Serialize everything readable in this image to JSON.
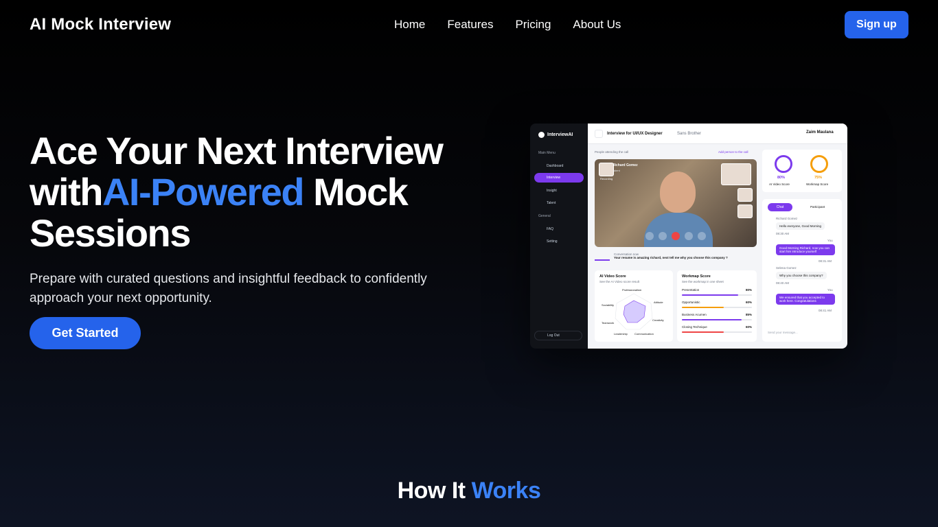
{
  "nav": {
    "logo": "AI Mock Interview",
    "links": [
      "Home",
      "Features",
      "Pricing",
      "About Us"
    ],
    "signup": "Sign up"
  },
  "hero": {
    "title_line1": "Ace Your Next Interview",
    "title_with": "with",
    "title_highlight": "AI-Powered",
    "title_rest": " Mock Sessions",
    "subtitle": "Prepare with curated questions and insightful feedback to confidently approach your next opportunity.",
    "cta": "Get Started"
  },
  "how": {
    "part1": "How It ",
    "part2": "Works"
  },
  "colors": {
    "accent": "#2563eb",
    "highlight": "#3b82f6",
    "mock_purple": "#7c3aed"
  },
  "mock": {
    "brand": "InterviewAI",
    "sections": {
      "main": "Main Menu",
      "general": "General"
    },
    "menu": [
      "Dashboard",
      "Interview",
      "Insight",
      "Talent"
    ],
    "general_items": [
      "FAQ",
      "Setting"
    ],
    "logout": "Log Out",
    "header_title": "Interview for UI/UX Designer",
    "header_sub": "Sans Brother",
    "user": "Zaim Maulana",
    "attending": "People attending the call",
    "add_person": "Add person to the call",
    "caller_name": "Richard Gomez",
    "caller_role": "Talent",
    "recording": "Recording",
    "conversation_label": "Conversation now",
    "conversation_text": "Your resume is amazing richard, next tell me why you choose this company ?",
    "ai_score_title": "AI Video Score",
    "ai_score_sub": "See the AI Video score result",
    "radar_labels": [
      "Professionalism",
      "Attitude",
      "Creativity",
      "Communication",
      "Leadership",
      "Teamwork",
      "Sociability"
    ],
    "work_title": "Workmap Score",
    "work_sub": "See the workmap in one sheet",
    "work_items": [
      {
        "label": "Presentation",
        "value": "80%",
        "pct": 0.8,
        "color": "#7c3aed"
      },
      {
        "label": "Opportunistic",
        "value": "60%",
        "pct": 0.6,
        "color": "#f59e0b"
      },
      {
        "label": "Business Acumen",
        "value": "85%",
        "pct": 0.85,
        "color": "#7c3aed"
      },
      {
        "label": "Closing Technique",
        "value": "60%",
        "pct": 0.6,
        "color": "#ef4444"
      }
    ],
    "scores": [
      {
        "value": "80%",
        "label": "AI Video Score",
        "color": "#7c3aed"
      },
      {
        "value": "75%",
        "label": "Workmap Score",
        "color": "#f59e0b"
      }
    ],
    "chat_tabs": [
      "Chat",
      "Participant"
    ],
    "messages": [
      {
        "name": "Richard Gomez",
        "text": "Hello everyone, Good Morning",
        "time": "08:30 AM"
      },
      {
        "name": "You",
        "text": "Good Morning Richard, now you can start him introduce yourself",
        "time": "08:31 AM"
      },
      {
        "name": "Selena Gomez",
        "text": "Why you choose this company?",
        "time": "08:40 AM"
      },
      {
        "name": "You",
        "text": "We ensured that you accepted to work here. Congratulations",
        "time": "08:41 AM"
      }
    ],
    "chat_placeholder": "Send your message..."
  }
}
